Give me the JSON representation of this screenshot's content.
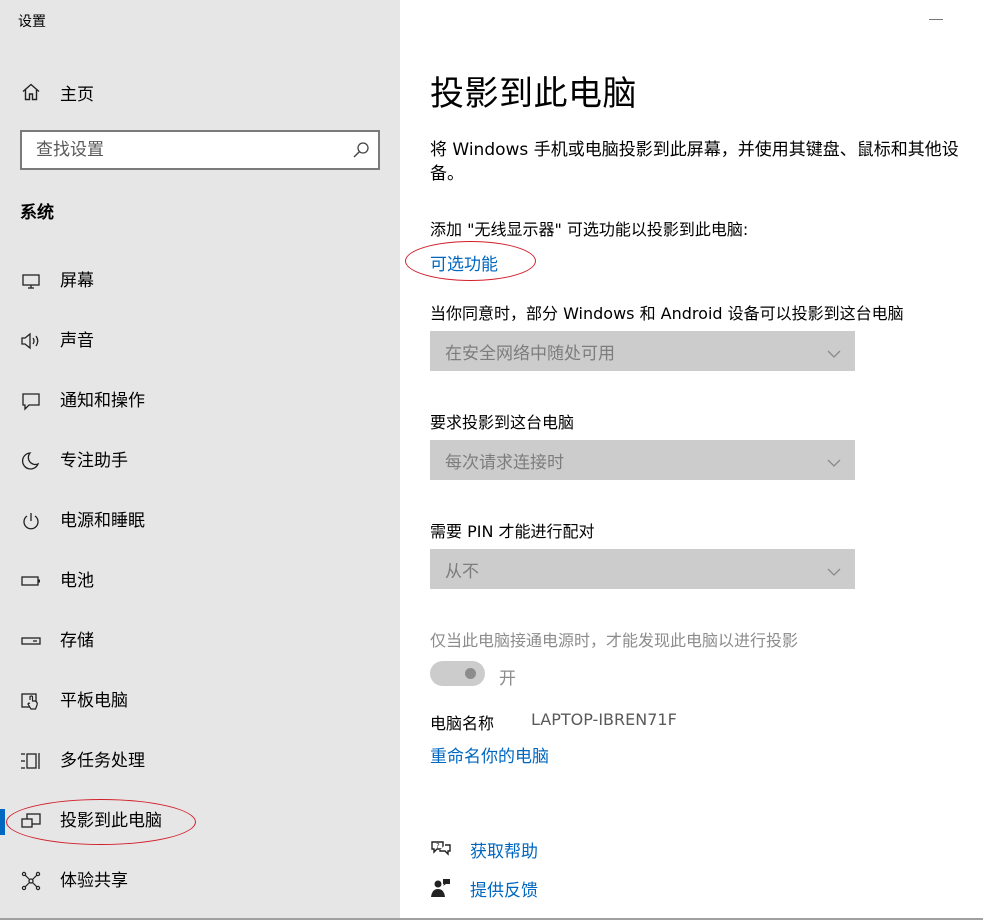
{
  "window": {
    "title": "设置"
  },
  "sidebar": {
    "home_label": "主页",
    "search_placeholder": "查找设置",
    "section_title": "系统",
    "items": [
      {
        "label": "屏幕",
        "icon": "monitor-icon"
      },
      {
        "label": "声音",
        "icon": "speaker-icon"
      },
      {
        "label": "通知和操作",
        "icon": "notification-icon"
      },
      {
        "label": "专注助手",
        "icon": "moon-icon"
      },
      {
        "label": "电源和睡眠",
        "icon": "power-icon"
      },
      {
        "label": "电池",
        "icon": "battery-icon"
      },
      {
        "label": "存储",
        "icon": "storage-icon"
      },
      {
        "label": "平板电脑",
        "icon": "tablet-icon"
      },
      {
        "label": "多任务处理",
        "icon": "multitasking-icon"
      },
      {
        "label": "投影到此电脑",
        "icon": "project-icon",
        "active": true
      },
      {
        "label": "体验共享",
        "icon": "share-icon"
      }
    ]
  },
  "main": {
    "title": "投影到此电脑",
    "description": "将 Windows 手机或电脑投影到此屏幕，并使用其键盘、鼠标和其他设备。",
    "add_feature_text": "添加 \"无线显示器\" 可选功能以投影到此电脑:",
    "optional_features_link": "可选功能",
    "settings": [
      {
        "label": "当你同意时，部分 Windows 和 Android 设备可以投影到这台电脑",
        "value": "在安全网络中随处可用"
      },
      {
        "label": "要求投影到这台电脑",
        "value": "每次请求连接时"
      },
      {
        "label": "需要 PIN 才能进行配对",
        "value": "从不"
      }
    ],
    "power_discover_label": "仅当此电脑接通电源时，才能发现此电脑以进行投影",
    "power_toggle_state": "开",
    "pc_name_label": "电脑名称",
    "pc_name_value": "LAPTOP-IBREN71F",
    "rename_link": "重命名你的电脑",
    "help_link": "获取帮助",
    "feedback_link": "提供反馈"
  },
  "colors": {
    "accent": "#0067c0",
    "sidebar_bg": "#e6e6e6",
    "annotation": "#d21e2a",
    "disabled_bg": "#cccccc"
  }
}
